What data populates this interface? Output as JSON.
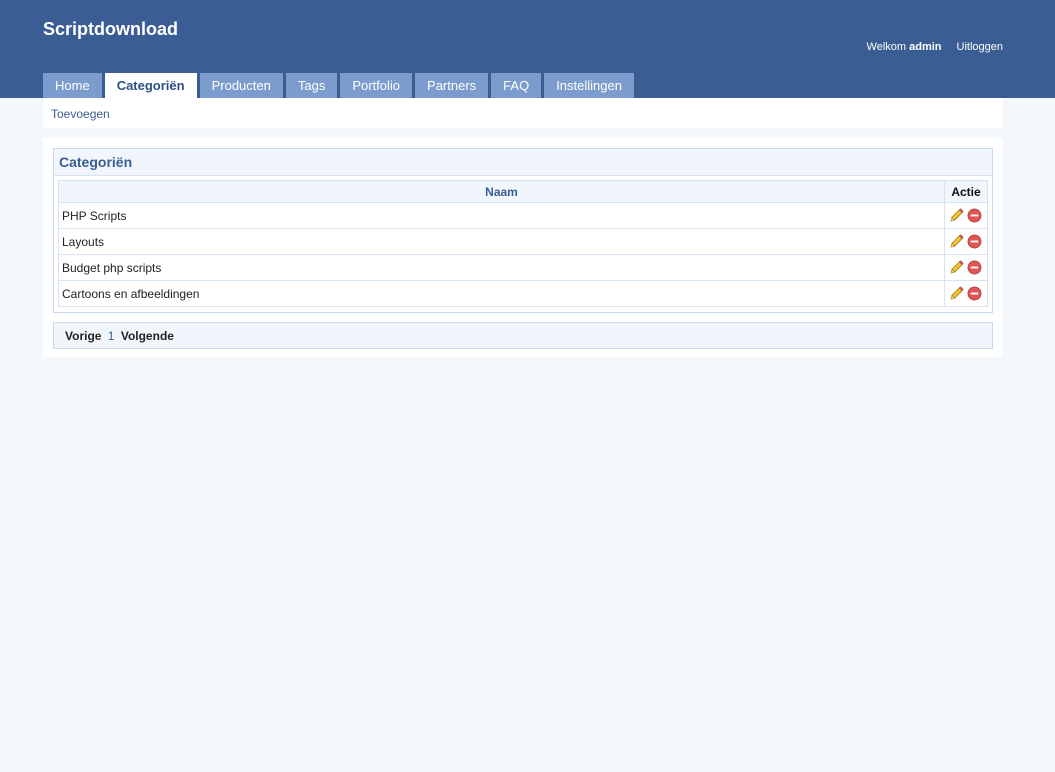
{
  "header": {
    "site_title": "Scriptdownload",
    "welcome_text": "Welkom",
    "username": "admin",
    "logout_label": "Uitloggen"
  },
  "nav": {
    "tabs": [
      {
        "label": "Home"
      },
      {
        "label": "Categoriën",
        "active": true
      },
      {
        "label": "Producten"
      },
      {
        "label": "Tags"
      },
      {
        "label": "Portfolio"
      },
      {
        "label": "Partners"
      },
      {
        "label": "FAQ"
      },
      {
        "label": "Instellingen"
      }
    ]
  },
  "subnav": {
    "add_label": "Toevoegen"
  },
  "panel": {
    "title": "Categoriën",
    "columns": {
      "name": "Naam",
      "action": "Actie"
    },
    "rows": [
      {
        "name": "PHP Scripts"
      },
      {
        "name": "Layouts"
      },
      {
        "name": "Budget php scripts"
      },
      {
        "name": "Cartoons en afbeeldingen"
      }
    ],
    "icons": {
      "edit": "pencil-icon",
      "delete": "delete-icon"
    }
  },
  "pagination": {
    "prev_label": "Vorige",
    "current_page": "1",
    "next_label": "Volgende"
  },
  "colors": {
    "header_bg": "#3a5d93",
    "tab_bg": "#7b9ccc",
    "page_bg": "#f3f8fd",
    "accent_text": "#3a5d93"
  }
}
